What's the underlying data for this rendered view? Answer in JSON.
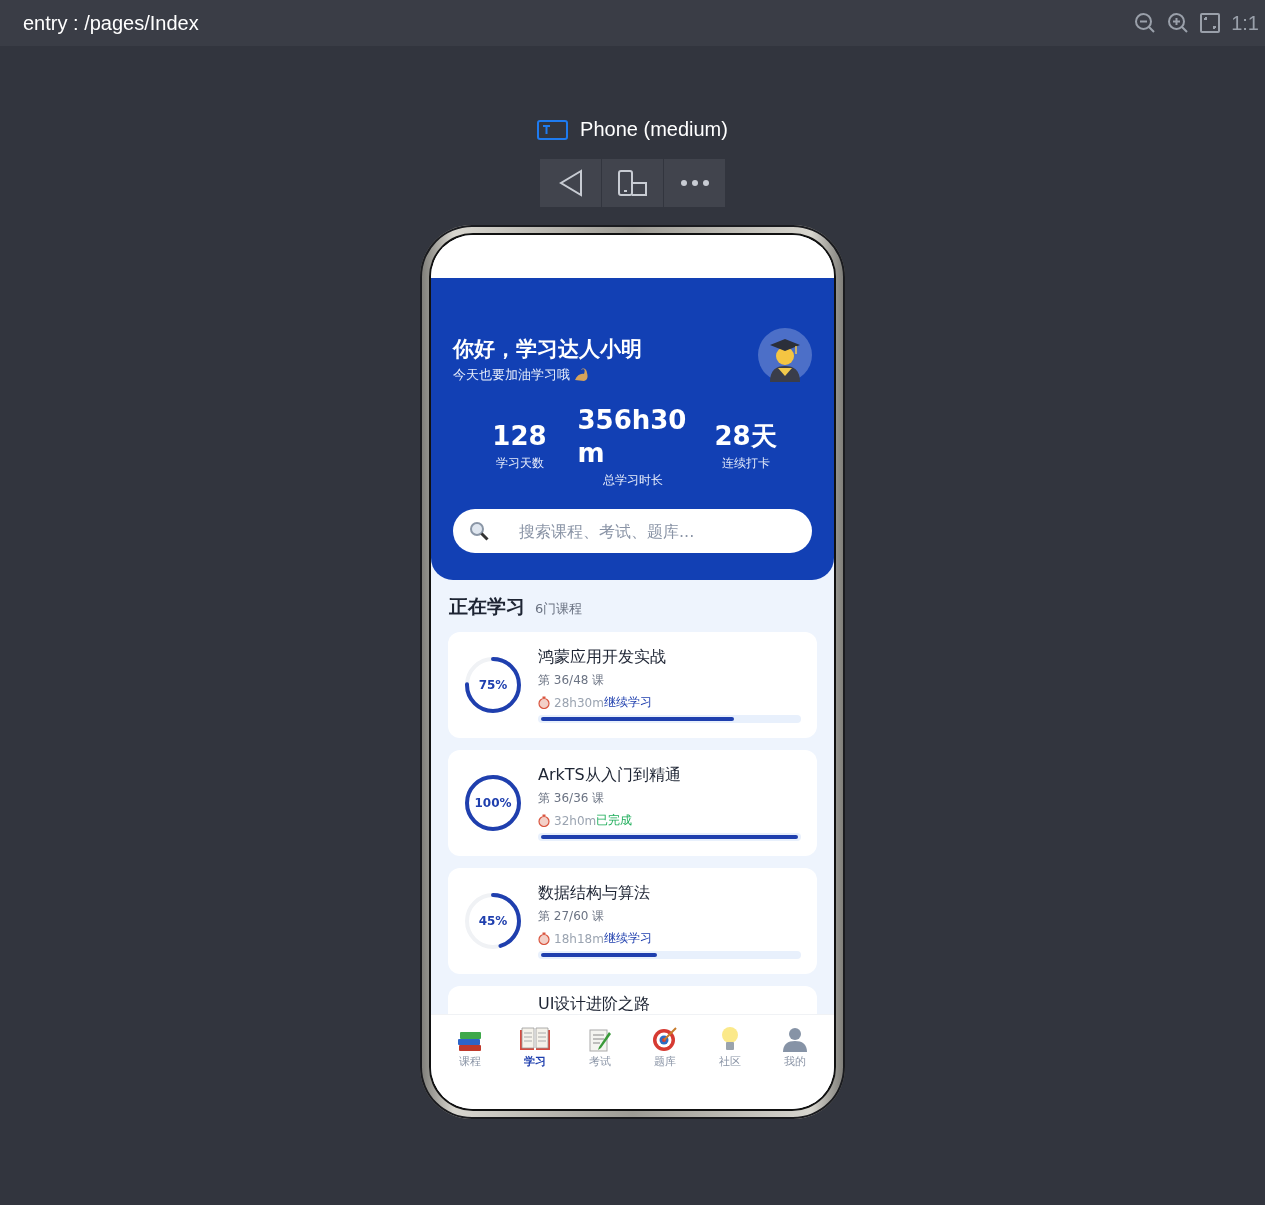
{
  "topbar": {
    "title": "entry : /pages/Index",
    "zoom_label": "1:1"
  },
  "device": {
    "name": "Phone (medium)"
  },
  "header": {
    "greeting": "你好，学习达人小明",
    "subtitle": "今天也要加油学习哦"
  },
  "stats": [
    {
      "value": "128",
      "label": "学习天数"
    },
    {
      "value": "356h30m",
      "label": "总学习时长"
    },
    {
      "value": "28天",
      "label": "连续打卡"
    }
  ],
  "search": {
    "placeholder": "搜索课程、考试、题库..."
  },
  "section": {
    "title": "正在学习",
    "count": "6门课程"
  },
  "courses": [
    {
      "title": "鸿蒙应用开发实战",
      "percent": "75%",
      "level": 0.75,
      "lesson": "第 36/48 课",
      "time": "28h30m",
      "status": "继续学习",
      "done": false
    },
    {
      "title": "ArkTS从入门到精通",
      "percent": "100%",
      "level": 1,
      "lesson": "第 36/36 课",
      "time": "32h0m",
      "status": "已完成",
      "done": true
    },
    {
      "title": "数据结构与算法",
      "percent": "45%",
      "level": 0.45,
      "lesson": "第 27/60 课",
      "time": "18h18m",
      "status": "继续学习",
      "done": false
    },
    {
      "title": "UI设计进阶之路"
    }
  ],
  "tabs": [
    {
      "label": "课程",
      "selected": false
    },
    {
      "label": "学习",
      "selected": true
    },
    {
      "label": "考试",
      "selected": false
    },
    {
      "label": "题库",
      "selected": false
    },
    {
      "label": "社区",
      "selected": false
    },
    {
      "label": "我的",
      "selected": false
    }
  ]
}
